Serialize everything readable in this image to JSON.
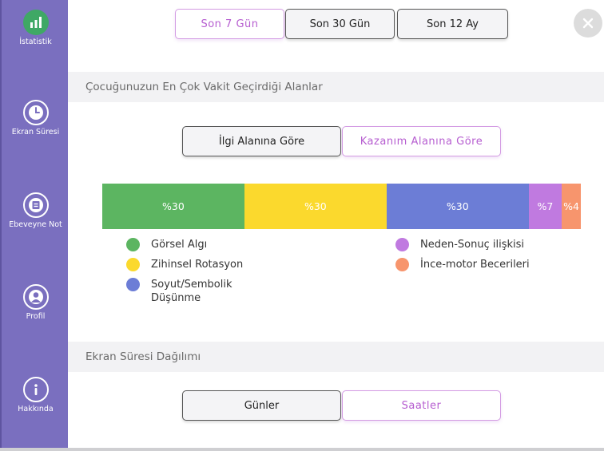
{
  "sidebar": {
    "items": [
      {
        "label": "İstatistik",
        "icon": "bar-chart-icon",
        "active": true
      },
      {
        "label": "Ekran Süresi",
        "icon": "clock-icon"
      },
      {
        "label": "Ebeveyne Not",
        "icon": "note-icon"
      },
      {
        "label": "Profil",
        "icon": "user-icon"
      },
      {
        "label": "Hakkında",
        "icon": "info-icon"
      }
    ]
  },
  "period_tabs": [
    {
      "label": "Son 7 Gün",
      "selected": true
    },
    {
      "label": "Son 30 Gün",
      "selected": false
    },
    {
      "label": "Son 12 Ay",
      "selected": false
    }
  ],
  "section1": {
    "title": "Çocuğunuzun En Çok Vakit Geçirdiği Alanlar",
    "tabs": [
      {
        "label": "İlgi Alanına Göre",
        "selected": false
      },
      {
        "label": "Kazanım Alanına Göre",
        "selected": true
      }
    ]
  },
  "distribution": [
    {
      "name": "Görsel Algı",
      "percent": 30,
      "label": "%30",
      "color": "#5cb561"
    },
    {
      "name": "Zihinsel Rotasyon",
      "percent": 30,
      "label": "%30",
      "color": "#fbd92d"
    },
    {
      "name": "Soyut/Sembolik Düşünme",
      "percent": 30,
      "label": "%30",
      "color": "#6c7dd6"
    },
    {
      "name": "Neden-Sonuç ilişkisi",
      "percent": 7,
      "label": "%7",
      "color": "#c07ae0"
    },
    {
      "name": "İnce-motor Becerileri",
      "percent": 4,
      "label": "%4",
      "color": "#f7956d"
    }
  ],
  "section2": {
    "title": "Ekran Süresi Dağılımı",
    "tabs": [
      {
        "label": "Günler",
        "selected": false
      },
      {
        "label": "Saatler",
        "selected": true
      }
    ]
  },
  "colors": {
    "sidebar": "#7a6fbf",
    "accent": "#b65dd0",
    "active_icon": "#3fa865"
  }
}
